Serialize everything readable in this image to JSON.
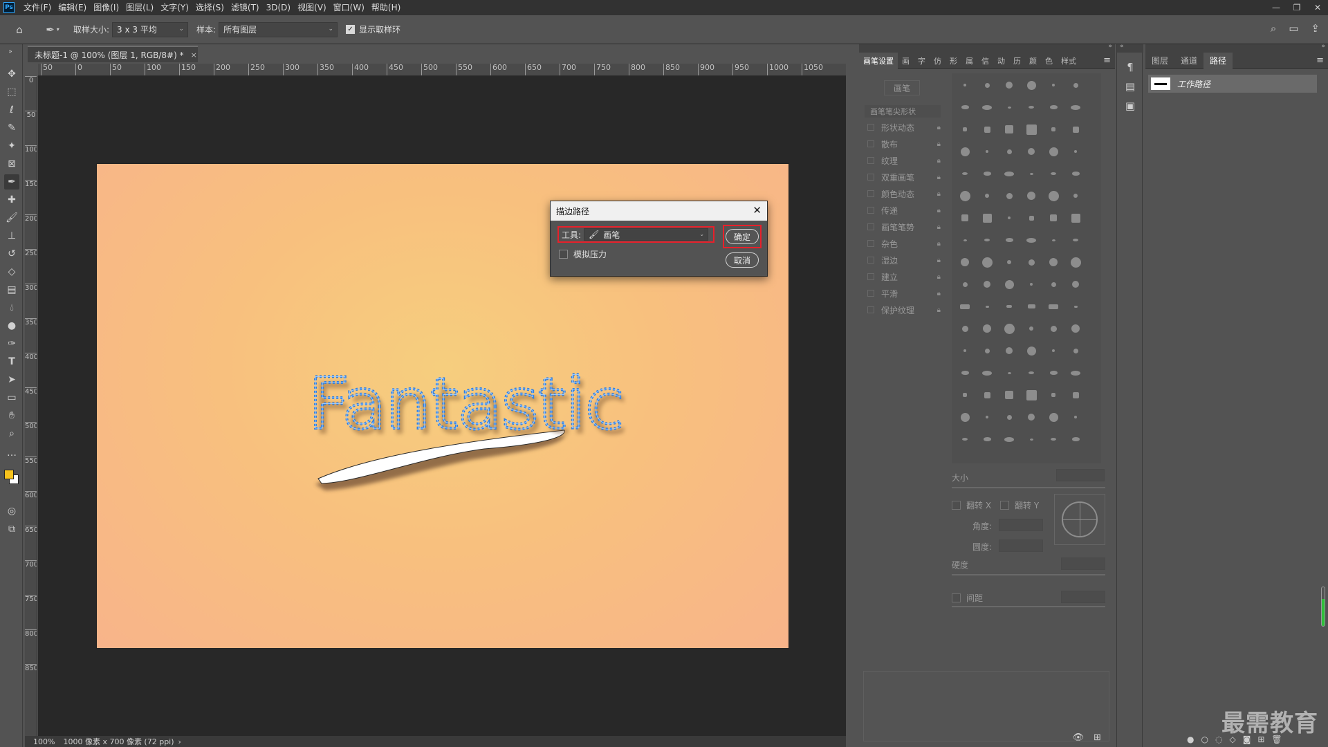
{
  "app": {
    "logo": "Ps"
  },
  "menu": [
    "文件(F)",
    "编辑(E)",
    "图像(I)",
    "图层(L)",
    "文字(Y)",
    "选择(S)",
    "滤镜(T)",
    "3D(D)",
    "视图(V)",
    "窗口(W)",
    "帮助(H)"
  ],
  "options": {
    "sample_size_label": "取样大小:",
    "sample_size_value": "3 x 3 平均",
    "sample_label": "样本:",
    "sample_value": "所有图层",
    "show_ring_label": "显示取样环",
    "show_ring_checked": true
  },
  "document": {
    "tab_title": "未标题-1 @ 100% (图层 1, RGB/8#) *",
    "status_zoom": "100%",
    "status_info": "1000 像素 x 700 像素 (72 ppi)",
    "canvas_text": "Fantastic",
    "ruler_h": [
      "50",
      "0",
      "50",
      "100",
      "150",
      "200",
      "250",
      "300",
      "350",
      "400",
      "450",
      "500",
      "550",
      "600",
      "650",
      "700",
      "750",
      "800",
      "850",
      "900",
      "950",
      "1000",
      "1050"
    ],
    "ruler_v": [
      "0",
      "50",
      "100",
      "150",
      "200",
      "250",
      "300",
      "350",
      "400",
      "450",
      "500",
      "550",
      "600",
      "650",
      "700",
      "750",
      "800",
      "850"
    ]
  },
  "dialog": {
    "title": "描边路径",
    "tool_label": "工具:",
    "tool_value": "画笔",
    "simulate_pressure": "模拟压力",
    "ok": "确定",
    "cancel": "取消"
  },
  "brush_panel": {
    "tabs": [
      "画笔设置",
      "画",
      "字",
      "仿",
      "形",
      "属",
      "信",
      "动",
      "历",
      "颜",
      "色",
      "样式"
    ],
    "brush_button": "画笔",
    "tip_shape": "画笔笔尖形状",
    "options": [
      "形状动态",
      "散布",
      "纹理",
      "双重画笔",
      "颜色动态",
      "传递",
      "画笔笔势",
      "杂色",
      "湿边",
      "建立",
      "平滑",
      "保护纹理"
    ],
    "size_label": "大小",
    "flip_x": "翻转 X",
    "flip_y": "翻转 Y",
    "angle_label": "角度:",
    "roundness_label": "圆度:",
    "hardness_label": "硬度",
    "spacing_label": "间距"
  },
  "paths_panel": {
    "tabs": [
      "图层",
      "通道",
      "路径"
    ],
    "active_tab": "路径",
    "work_path": "工作路径"
  },
  "watermark": "最需教育",
  "colors": {
    "foreground": "#f7c21c",
    "background": "#ffffff",
    "path_stroke": "#2f7fe0",
    "highlight": "#e8202a"
  }
}
